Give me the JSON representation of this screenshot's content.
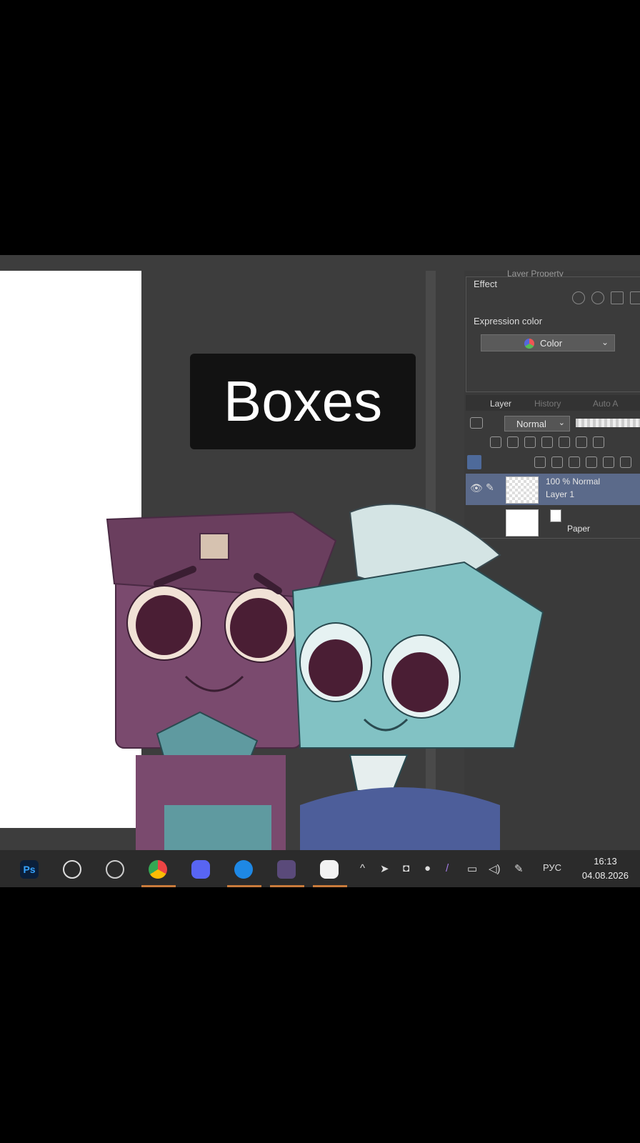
{
  "overlay_title": "Boxes",
  "panels": {
    "layer_property_tab": "Layer Property",
    "effect_label": "Effect",
    "expression_color_label": "Expression color",
    "expression_color_value": "Color",
    "layer_tabs": [
      "Layer",
      "History",
      "Auto A"
    ],
    "blend_mode": "Normal"
  },
  "layers": [
    {
      "line1": "100 % Normal",
      "line2": "Layer 1",
      "selected": true
    },
    {
      "name": "Paper",
      "selected": false
    }
  ],
  "taskbar": {
    "apps": [
      "photoshop-icon",
      "recorder-icon",
      "obs-icon",
      "chrome-icon",
      "discord-icon",
      "messenger-icon",
      "game-icon",
      "clip-studio-icon"
    ],
    "tray": [
      "chevron-up-icon",
      "telegram-icon",
      "camera-icon",
      "mic-icon",
      "pen-icon",
      "network-icon",
      "volume-icon",
      "stylus-icon"
    ],
    "language": "РУС",
    "time": "16:13",
    "date": "04.08.2026"
  }
}
